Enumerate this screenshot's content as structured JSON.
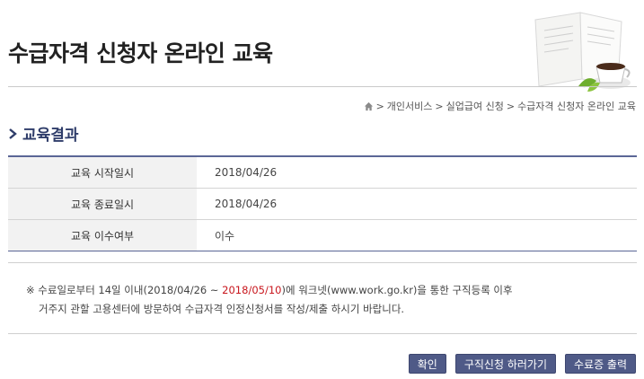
{
  "page": {
    "title": "수급자격 신청자 온라인 교육"
  },
  "breadcrumb": {
    "items": [
      "개인서비스",
      "실업급여 신청",
      "수급자격 신청자 온라인 교육"
    ],
    "separator": ">"
  },
  "section": {
    "title": "교육결과"
  },
  "result_table": {
    "rows": [
      {
        "label": "교육 시작일시",
        "value": "2018/04/26"
      },
      {
        "label": "교육 종료일시",
        "value": "2018/04/26"
      },
      {
        "label": "교육 이수여부",
        "value": "이수"
      }
    ]
  },
  "notice": {
    "prefix": "※ 수료일로부터 14일 이내(2018/04/26 ~ ",
    "deadline": "2018/05/10",
    "middle": ")에 ",
    "site_name": "워크넷",
    "suffix": "(www.work.go.kr)을 통한 구직등록 이후",
    "line2": "거주지 관할 고용센터에 방문하여 수급자격 인정신청서를 작성/제출 하시기 바랍니다."
  },
  "buttons": {
    "confirm": "확인",
    "job_application": "구직신청 하러가기",
    "print_certificate": "수료증 출력"
  },
  "colors": {
    "accent": "#4f5a87",
    "deadline_red": "#c8161d",
    "section_title": "#2f3d6a"
  },
  "icons": {
    "home": "home-icon",
    "section_marker": "chevron-right-icon",
    "illustration": "book-and-coffee-illustration"
  }
}
